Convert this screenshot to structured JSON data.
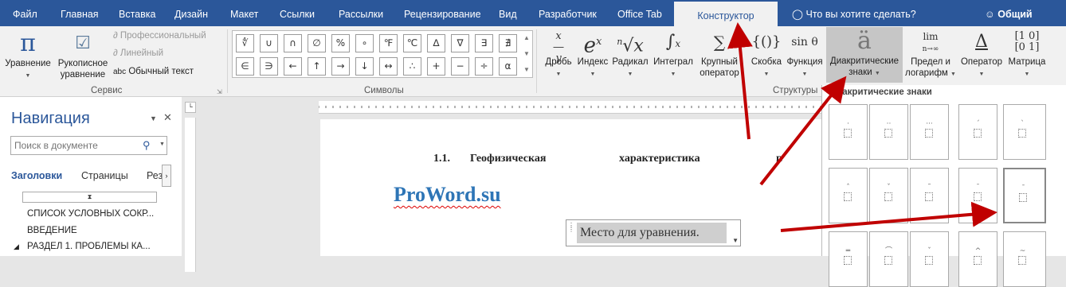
{
  "tabs": [
    "Файл",
    "Главная",
    "Вставка",
    "Дизайн",
    "Макет",
    "Ссылки",
    "Рассылки",
    "Рецензирование",
    "Вид",
    "Разработчик",
    "Office Tab",
    "Конструктор"
  ],
  "tell_me": "Что вы хотите сделать?",
  "share": "Общий доступ",
  "ribbon": {
    "service": {
      "equation": "Уравнение",
      "handwritten_1": "Рукописное",
      "handwritten_2": "уравнение",
      "professional": "Профессиональный",
      "linear": "Линейный",
      "plain_text_icon": "abc",
      "plain_text": "Обычный текст",
      "group_label": "Сервис"
    },
    "symbols": {
      "row1": [
        "∜",
        "∪",
        "∩",
        "∅",
        "%",
        "∘",
        "℉",
        "℃",
        "∆",
        "∇",
        "∃",
        "∄"
      ],
      "row2": [
        "∈",
        "∋",
        "←",
        "↑",
        "→",
        "↓",
        "↔",
        "∴",
        "+",
        "−",
        "÷",
        "α"
      ],
      "group_label": "Символы"
    },
    "structures": {
      "fraction": "Дробь",
      "index": "Индекс",
      "radical": "Радикал",
      "integral": "Интеграл",
      "large_op_1": "Крупный",
      "large_op_2": "оператор",
      "bracket": "Скобка",
      "function": "Функция",
      "accent_1": "Диакритические",
      "accent_2": "знаки",
      "limit_1": "Предел и",
      "limit_2": "логарифм",
      "operator": "Оператор",
      "matrix": "Матрица",
      "group_label": "Структуры",
      "glyph_bracket": "{()}",
      "glyph_function": "sin θ",
      "glyph_accent": "ä",
      "glyph_limit_top": "lim",
      "glyph_limit_bottom": "n→∞",
      "glyph_operator": "Δ"
    }
  },
  "nav": {
    "title": "Навигация",
    "search_placeholder": "Поиск в документе",
    "tabs": [
      "Заголовки",
      "Страницы",
      "Рез"
    ],
    "items": [
      "СПИСОК УСЛОВНЫХ СОКР...",
      "ВВЕДЕНИЕ",
      "РАЗДЕЛ 1.  ПРОБЛЕМЫ КА..."
    ]
  },
  "document": {
    "heading_num": "1.1.",
    "heading_w1": "Геофизическая",
    "heading_w2": "характеристика",
    "heading_w3": "г.",
    "brand": "ProWord.su",
    "placeholder": "Место для уравнения."
  },
  "gallery": {
    "title": "Диакритические знаки"
  },
  "colors": {
    "accent": "#2b579a",
    "arrow": "#c00000",
    "brand_text": "#2e75b6"
  }
}
